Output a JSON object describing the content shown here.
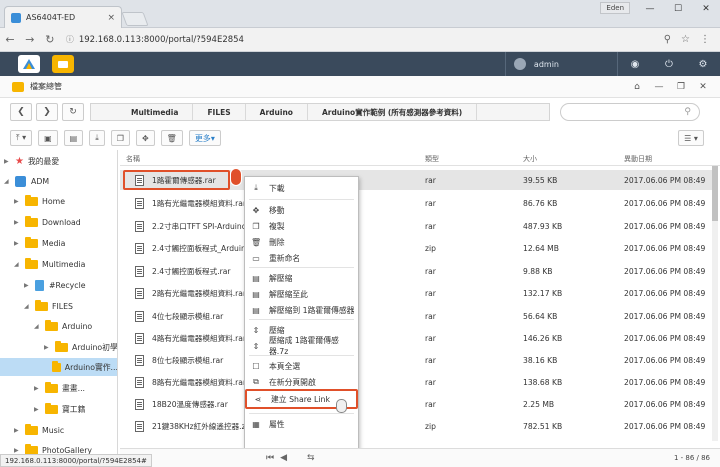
{
  "browser": {
    "tab_title": "AS6404T-ED",
    "tab_close": "×",
    "profile": "Eden",
    "url": "192.168.0.113:8000/portal/?594E2854",
    "status_url": "192.168.0.113:8000/portal/?594E2854#"
  },
  "adm": {
    "user": "admin"
  },
  "window": {
    "title": "檔案總管"
  },
  "breadcrumbs": [
    "Multimedia",
    "FILES",
    "Arduino",
    "Arduino實作範例 (所有感測器參考資料)"
  ],
  "toolbar": {
    "more_label": "更多"
  },
  "sidebar": {
    "items": [
      {
        "label": "我的最愛"
      },
      {
        "label": "ADM"
      },
      {
        "label": "Home"
      },
      {
        "label": "Download"
      },
      {
        "label": "Media"
      },
      {
        "label": "Multimedia"
      },
      {
        "label": "#Recycle"
      },
      {
        "label": "FILES"
      },
      {
        "label": "Arduino"
      },
      {
        "label": "Arduino初學..."
      },
      {
        "label": "Arduino實作..."
      },
      {
        "label": "畫畫..."
      },
      {
        "label": "寶工籍"
      },
      {
        "label": "Music"
      },
      {
        "label": "PhotoGallery"
      }
    ]
  },
  "columns": {
    "name": "名稱",
    "type": "類型",
    "size": "大小",
    "date": "異動日期"
  },
  "files": [
    {
      "name": "1路霍爾傳感器.rar",
      "type": "rar",
      "size": "39.55 KB",
      "date": "2017.06.06 PM 08:49"
    },
    {
      "name": "1路有光繼電器模組資料.rar",
      "type": "rar",
      "size": "86.76 KB",
      "date": "2017.06.06 PM 08:49"
    },
    {
      "name": "2.2寸串口TFT SPI-Arduino-C",
      "type": "rar",
      "size": "487.93 KB",
      "date": "2017.06.06 PM 08:49"
    },
    {
      "name": "2.4寸觸控面板程式_Arduino_",
      "type": "zip",
      "size": "12.64 MB",
      "date": "2017.06.06 PM 08:49"
    },
    {
      "name": "2.4寸觸控面板程式.rar",
      "type": "rar",
      "size": "9.88 KB",
      "date": "2017.06.06 PM 08:49"
    },
    {
      "name": "2路有光繼電器模組資料.rar",
      "type": "rar",
      "size": "132.17 KB",
      "date": "2017.06.06 PM 08:49"
    },
    {
      "name": "4位七段顯示模組.rar",
      "type": "rar",
      "size": "56.64 KB",
      "date": "2017.06.06 PM 08:49"
    },
    {
      "name": "4路有光繼電器模組資料.rar",
      "type": "rar",
      "size": "146.26 KB",
      "date": "2017.06.06 PM 08:49"
    },
    {
      "name": "8位七段顯示模組.rar",
      "type": "rar",
      "size": "38.16 KB",
      "date": "2017.06.06 PM 08:49"
    },
    {
      "name": "8路有光繼電器模組資料.rar",
      "type": "rar",
      "size": "138.68 KB",
      "date": "2017.06.06 PM 08:49"
    },
    {
      "name": "18B20溫度傳感器.rar",
      "type": "rar",
      "size": "2.25 MB",
      "date": "2017.06.06 PM 08:49"
    },
    {
      "name": "21鍵38KHz紅外線遙控器.zip",
      "type": "zip",
      "size": "782.51 KB",
      "date": "2017.06.06 PM 08:49"
    }
  ],
  "context_menu": [
    {
      "label": "下載",
      "icon": "download-icon",
      "glyph": "⤓"
    },
    {
      "label": "移動",
      "icon": "move-icon",
      "glyph": "✥"
    },
    {
      "label": "複製",
      "icon": "copy-icon",
      "glyph": "❐"
    },
    {
      "label": "刪除",
      "icon": "trash-icon",
      "glyph": "🗑"
    },
    {
      "label": "重新命名",
      "icon": "rename-icon",
      "glyph": "▭"
    },
    {
      "label": "解壓縮",
      "icon": "extract-icon",
      "glyph": "▤"
    },
    {
      "label": "解壓縮至此",
      "icon": "extract-here-icon",
      "glyph": "▤"
    },
    {
      "label": "解壓縮到 1路霍爾傳感器",
      "icon": "extract-to-icon",
      "glyph": "▤"
    },
    {
      "label": "壓縮",
      "icon": "compress-icon",
      "glyph": "⇕"
    },
    {
      "label": "壓縮成 1路霍爾傳感器.7z",
      "icon": "compress-to-icon",
      "glyph": "⇕"
    },
    {
      "label": "本頁全選",
      "icon": "select-all-icon",
      "glyph": "☐"
    },
    {
      "label": "在新分頁開啟",
      "icon": "new-tab-icon",
      "glyph": "⧉"
    },
    {
      "label": "建立 Share Link",
      "icon": "share-link-icon",
      "glyph": "⋖"
    },
    {
      "label": "屬性",
      "icon": "properties-icon",
      "glyph": "▦"
    }
  ],
  "pagination": {
    "count": "1 - 86 / 86"
  },
  "colors": {
    "adm_bar": "#3a4a5c",
    "highlight": "#e0502a",
    "folder": "#f7b500",
    "selected": "#bcdcf5"
  }
}
